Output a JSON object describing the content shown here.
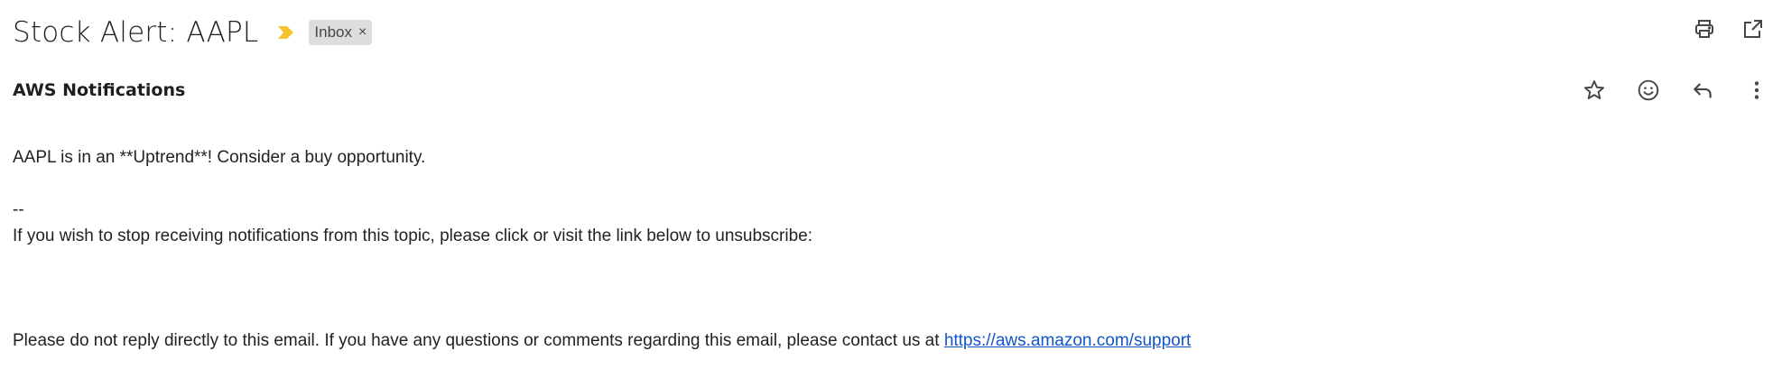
{
  "email": {
    "subject": "Stock Alert: AAPL",
    "importance_icon": "importance-marker-icon",
    "label_chip": {
      "text": "Inbox",
      "remove_symbol": "×"
    },
    "toolbar": {
      "print_icon": "print-icon",
      "open_new_window_icon": "open-in-new-window-icon"
    },
    "sender": "AWS Notifications",
    "message_actions": {
      "star_icon": "star-icon",
      "emoji_icon": "emoji-reaction-icon",
      "reply_icon": "reply-icon",
      "more_icon": "more-vert-icon"
    },
    "body": {
      "line1": "AAPL is in an **Uptrend**! Consider a buy opportunity.",
      "separator": "--",
      "unsubscribe_text": "If you wish to stop receiving notifications from this topic, please click or visit the link below to unsubscribe:",
      "contact_text": "Please do not reply directly to this email. If you have any questions or comments regarding this email, please contact us at ",
      "support_link": "https://aws.amazon.com/support"
    }
  },
  "colors": {
    "importance": "#f4c430",
    "chip_bg": "#dddddd",
    "link": "#1155cc",
    "icon": "#444746"
  }
}
